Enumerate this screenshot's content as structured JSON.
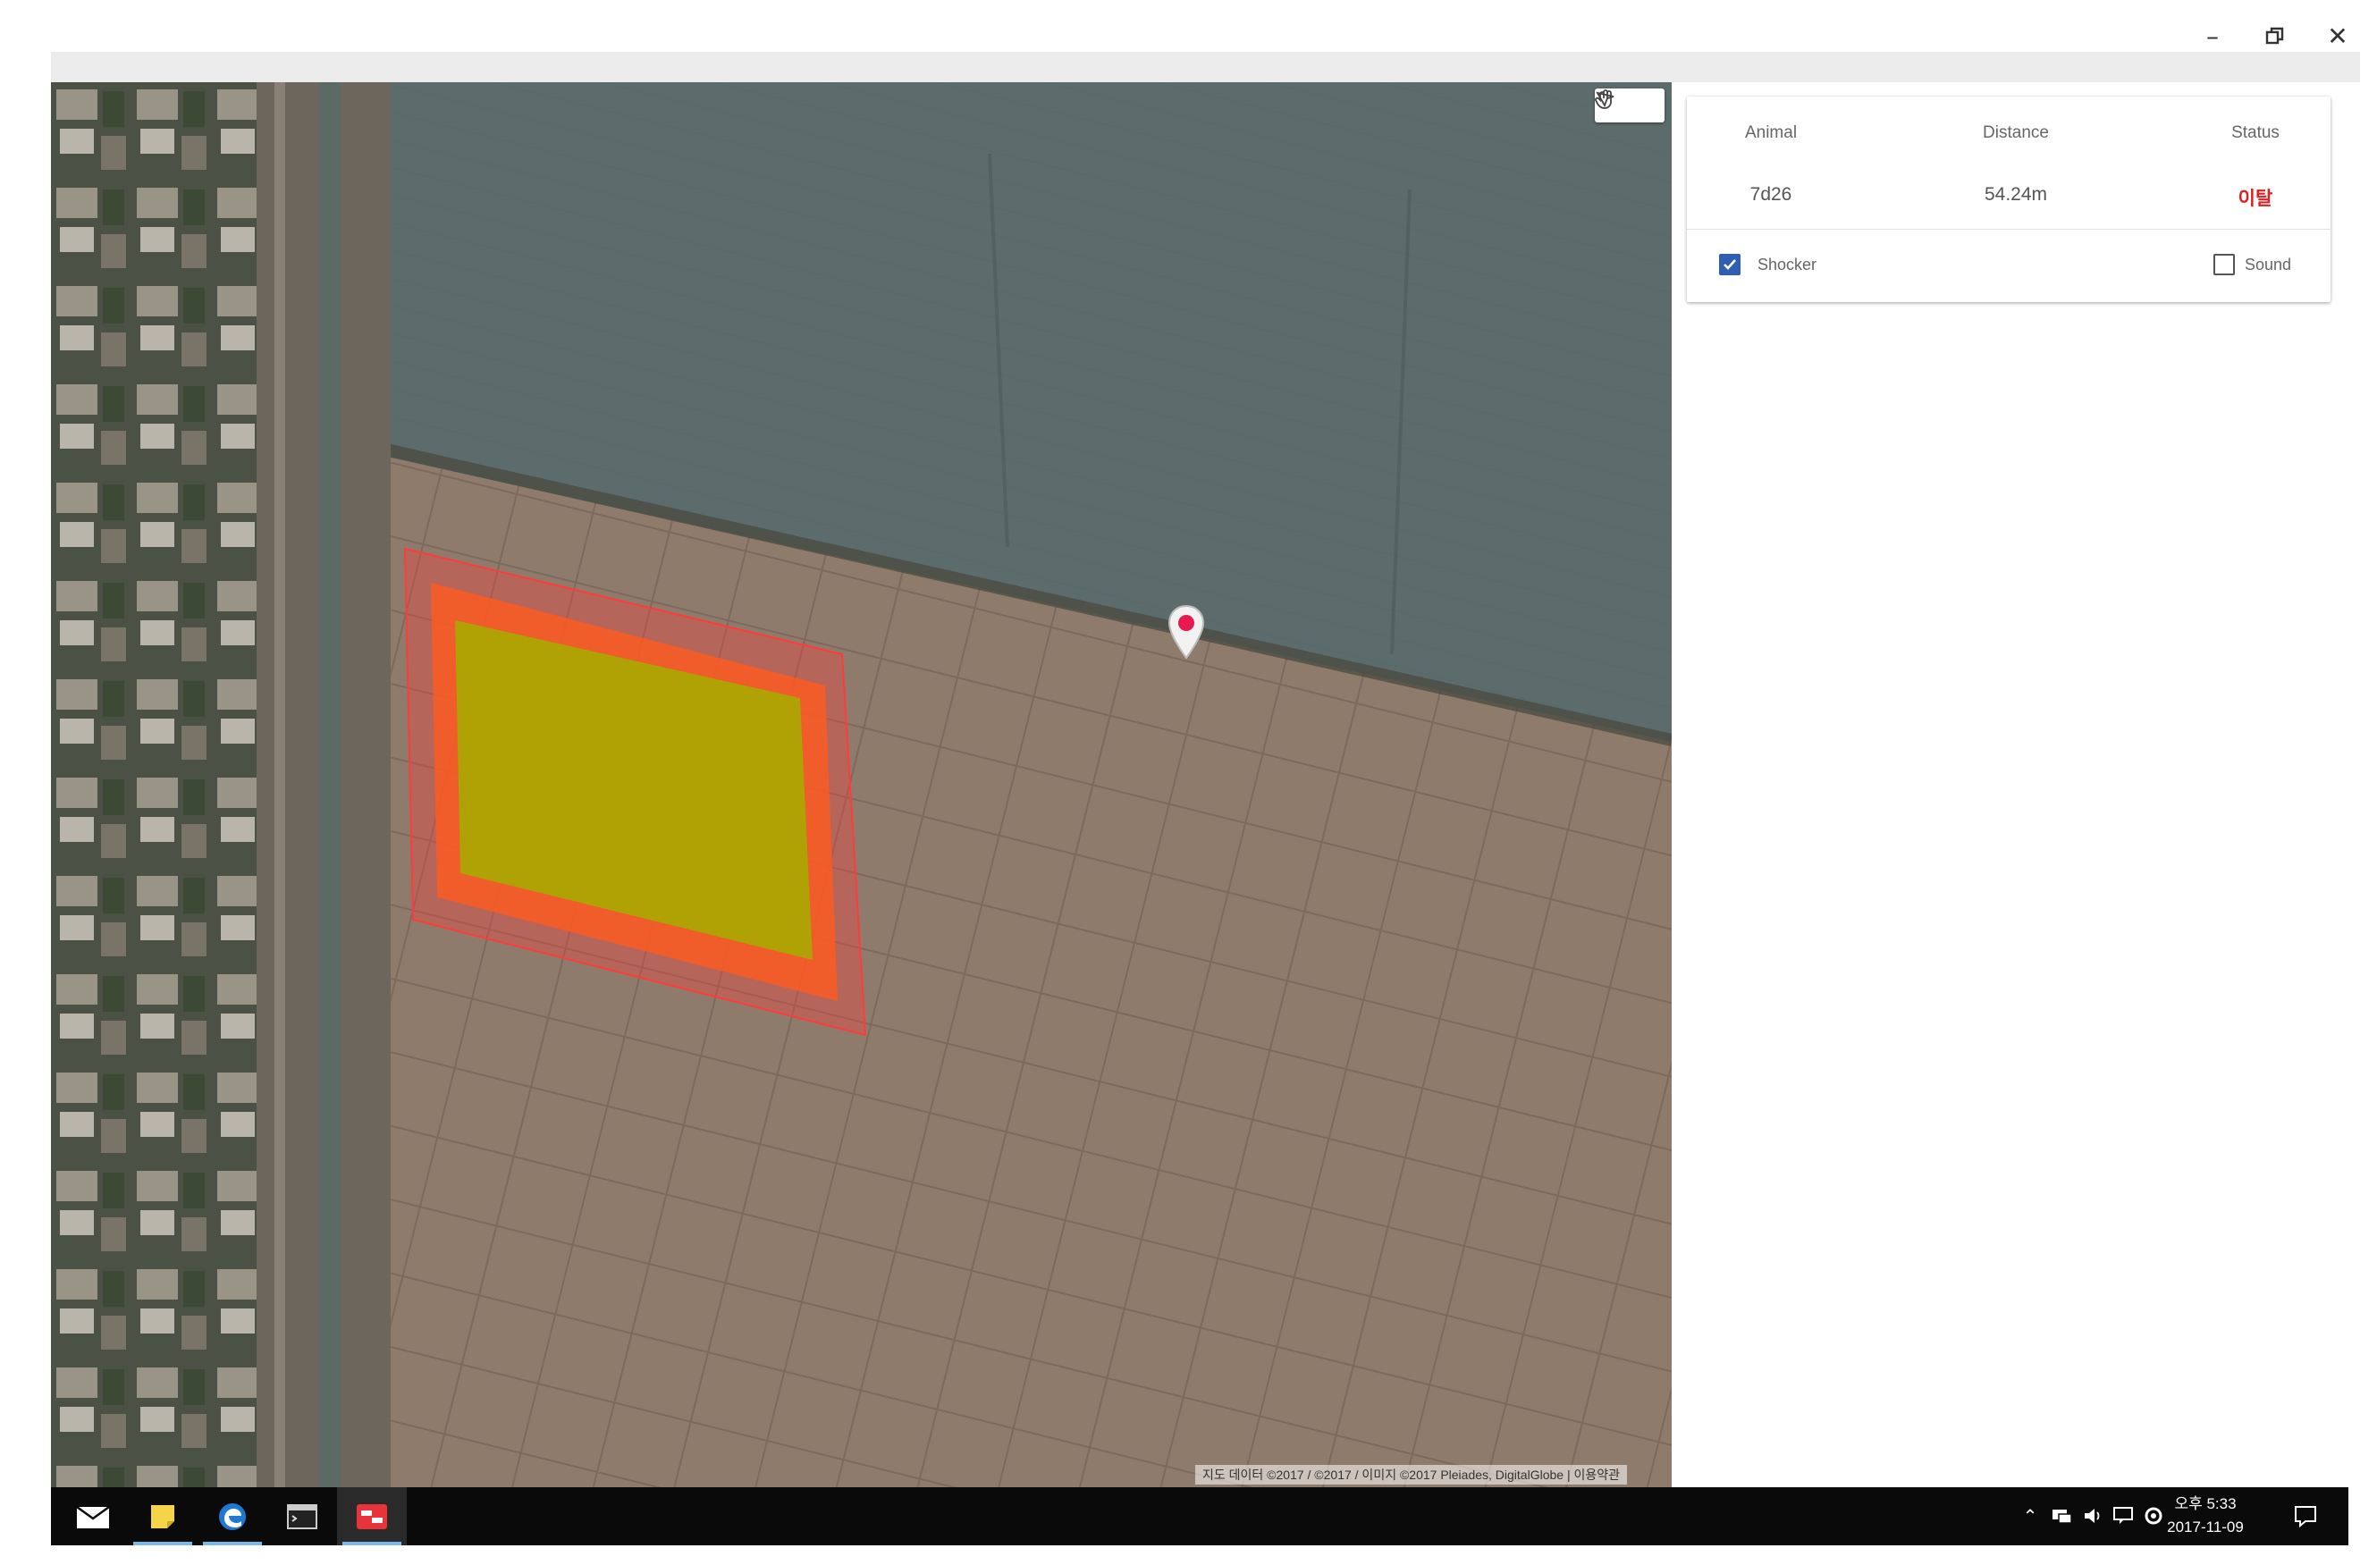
{
  "window": {
    "minimize_icon": "minimize-icon",
    "restore_icon": "restore-icon",
    "close_icon": "close-icon"
  },
  "map": {
    "toolbar_icons": [
      "pan-hand-icon",
      "draw-shape-icon"
    ],
    "marker_icon": "map-pin-icon",
    "attribution": "지도 데이터 ©2017 / ©2017 / 이미지 ©2017 Pleiades, DigitalGlobe | 이용약관",
    "colors": {
      "fence_outer": "#ff3b3b",
      "fence_middle": "#ff5a1e",
      "fence_inner": "#a8a800",
      "marker": "#e8194f"
    }
  },
  "panel": {
    "headers": {
      "animal": "Animal",
      "distance": "Distance",
      "status": "Status"
    },
    "row": {
      "animal": "7d26",
      "distance": "54.24m",
      "status": "이탈"
    },
    "status_color": "#e02020",
    "shocker": {
      "label": "Shocker",
      "checked": true
    },
    "sound": {
      "label": "Sound",
      "checked": false
    }
  },
  "taskbar": {
    "apps": [
      "mail-icon",
      "sticky-notes-icon",
      "edge-browser-icon",
      "terminal-icon",
      "geofence-app-icon"
    ],
    "tray": [
      "chevron-up-icon",
      "network-icon",
      "volume-icon",
      "message-icon",
      "settings-icon"
    ],
    "clock": {
      "time": "오후 5:33",
      "date": "2017-11-09"
    },
    "notification_icon": "action-center-icon"
  }
}
